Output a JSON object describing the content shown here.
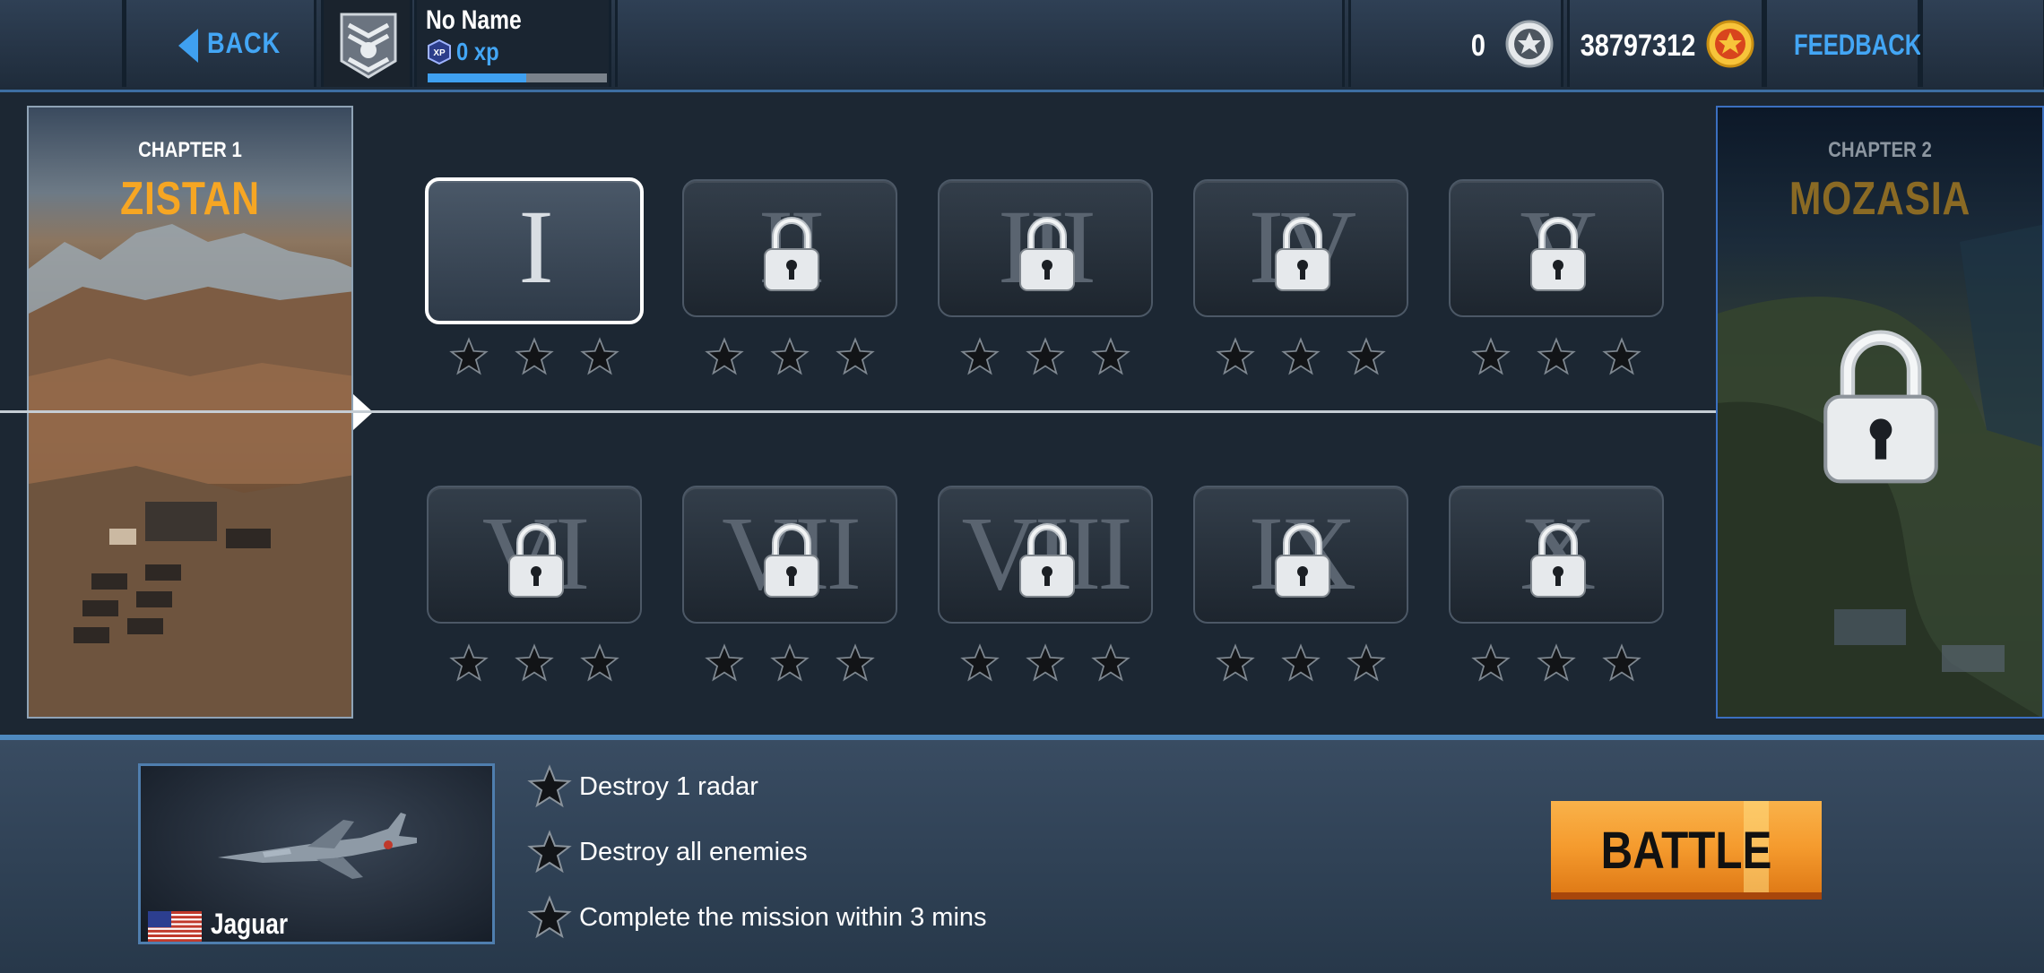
{
  "topbar": {
    "back_label": "BACK",
    "player_name": "No Name",
    "xp_text": "0 xp",
    "xp_progress": 0.55,
    "silver_count": "0",
    "gold_count": "38797312",
    "feedback_label": "FEEDBACK"
  },
  "chapter1": {
    "label": "CHAPTER 1",
    "name": "ZISTAN"
  },
  "chapter2": {
    "label": "CHAPTER 2",
    "name": "MOZASIA",
    "locked": true
  },
  "missions": [
    {
      "numeral": "I",
      "locked": false,
      "selected": true,
      "stars": 0
    },
    {
      "numeral": "II",
      "locked": true,
      "stars": 0
    },
    {
      "numeral": "III",
      "locked": true,
      "stars": 0
    },
    {
      "numeral": "IV",
      "locked": true,
      "stars": 0
    },
    {
      "numeral": "V",
      "locked": true,
      "stars": 0
    },
    {
      "numeral": "VI",
      "locked": true,
      "stars": 0
    },
    {
      "numeral": "VII",
      "locked": true,
      "stars": 0
    },
    {
      "numeral": "VIII",
      "locked": true,
      "stars": 0
    },
    {
      "numeral": "IX",
      "locked": true,
      "stars": 0
    },
    {
      "numeral": "X",
      "locked": true,
      "stars": 0
    }
  ],
  "aircraft": {
    "name": "Jaguar",
    "flag": "us-flag"
  },
  "objectives": [
    "Destroy 1 radar",
    "Destroy all enemies",
    "Complete the mission within 3 mins"
  ],
  "battle_label": "BATTLE",
  "colors": {
    "accent_blue": "#43a6f5",
    "gold": "#f6a623",
    "battle_orange": "#f59b2e"
  }
}
